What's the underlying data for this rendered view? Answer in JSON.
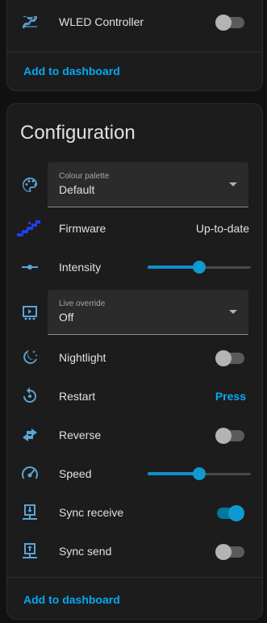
{
  "colors": {
    "accent": "#03a9f4",
    "icon": "#5aa5d6",
    "firmware_icon": "#1e3ff0",
    "card_bg": "#1c1c1c",
    "page_bg": "#111111"
  },
  "top_card": {
    "entity_label": "WLED Controller",
    "entity_icon": "led-strip-icon",
    "toggle_state": "off",
    "add_link": "Add to dashboard"
  },
  "config_card": {
    "title": "Configuration",
    "rows": {
      "colour_palette": {
        "icon": "palette-icon",
        "select_label": "Colour palette",
        "select_value": "Default"
      },
      "firmware": {
        "icon": "firmware-update-icon",
        "label": "Firmware",
        "value": "Up-to-date"
      },
      "intensity": {
        "icon": "slider-icon",
        "label": "Intensity",
        "level": 0.5
      },
      "live_override": {
        "icon": "live-override-icon",
        "select_label": "Live override",
        "select_value": "Off"
      },
      "nightlight": {
        "icon": "nightlight-icon",
        "label": "Nightlight",
        "toggle_state": "off"
      },
      "restart": {
        "icon": "restart-icon",
        "label": "Restart",
        "action": "Press"
      },
      "reverse": {
        "icon": "reverse-icon",
        "label": "Reverse",
        "toggle_state": "off"
      },
      "speed": {
        "icon": "speedometer-icon",
        "label": "Speed",
        "level": 0.5
      },
      "sync_receive": {
        "icon": "sync-receive-icon",
        "label": "Sync receive",
        "toggle_state": "on"
      },
      "sync_send": {
        "icon": "sync-send-icon",
        "label": "Sync send",
        "toggle_state": "off"
      }
    },
    "add_link": "Add to dashboard"
  }
}
